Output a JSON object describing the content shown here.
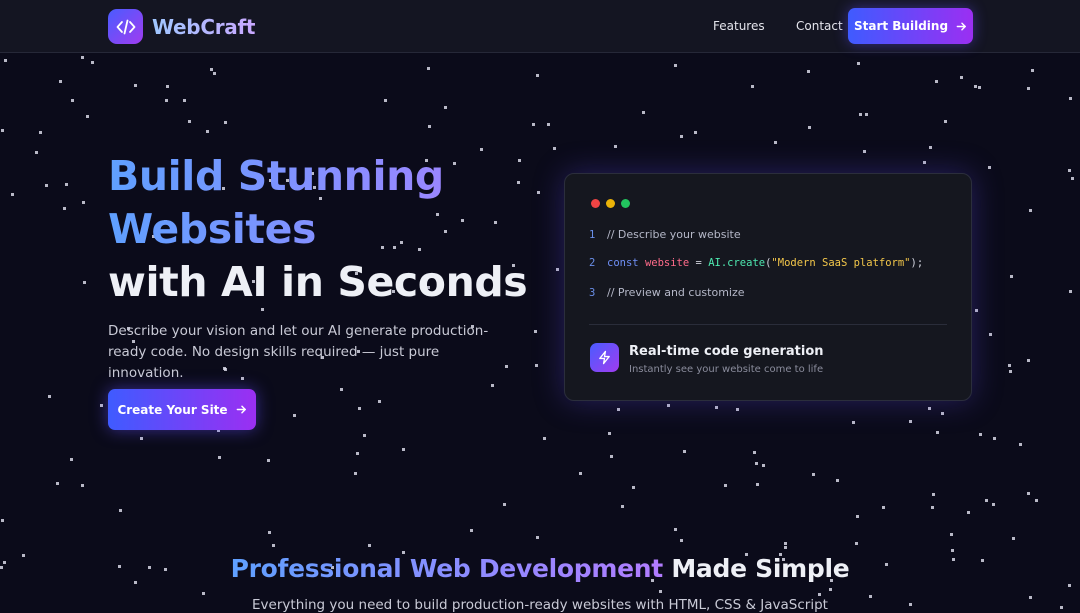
{
  "nav": {
    "brand": "WebCraft",
    "links": {
      "features": "Features",
      "contact": "Contact"
    },
    "cta_label": "Start Building"
  },
  "hero": {
    "title_line1": "Build Stunning",
    "title_line2": "Websites",
    "title_line3": "with AI in Seconds",
    "description": "Describe your vision and let our AI generate production-ready code. No design skills required — just pure innovation.",
    "cta_label": "Create Your Site"
  },
  "code_card": {
    "line1": {
      "num": "1",
      "text": "// Describe your website"
    },
    "line2": {
      "num": "2",
      "kw": "const",
      "var": "website",
      "eq": "=",
      "fn": "AI.create",
      "open": "(",
      "str": "\"Modern SaaS platform\"",
      "close": ");"
    },
    "line3": {
      "num": "3",
      "text": "// Preview and customize"
    },
    "feature_title": "Real-time code generation",
    "feature_subtitle": "Instantly see your website come to life"
  },
  "section": {
    "title_gradient": "Professional Web Development",
    "title_plain": "Made Simple",
    "subtitle": "Everything you need to build production-ready websites with HTML, CSS & JavaScript"
  },
  "colors": {
    "background": "#0b0b1a",
    "accent_start": "#3f5bff",
    "accent_end": "#9b2ff2",
    "dot_red": "#ef4444",
    "dot_yellow": "#eab308",
    "dot_green": "#22c55e"
  },
  "icons": {
    "logo": "code-brackets-icon",
    "cta_arrow": "arrow-right-icon",
    "feature": "lightning-icon"
  }
}
